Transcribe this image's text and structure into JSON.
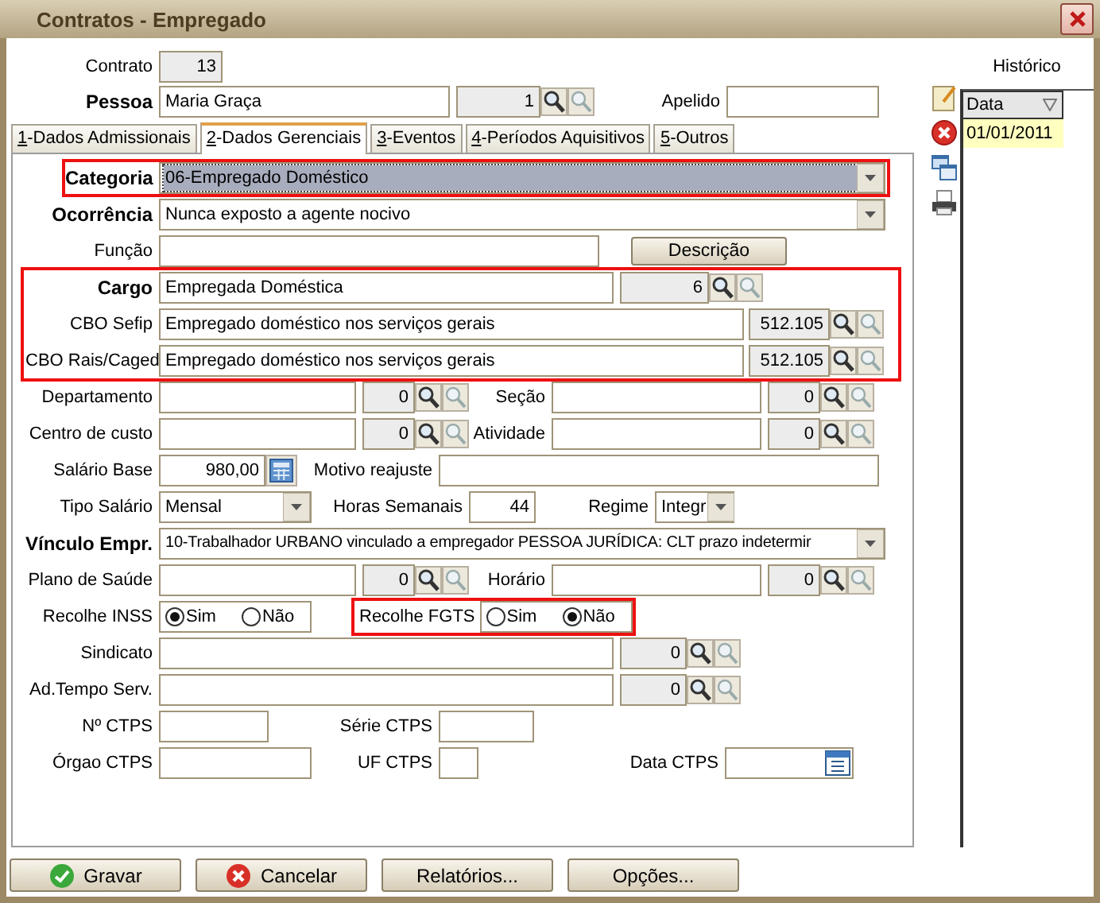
{
  "window": {
    "title": "Contratos - Empregado"
  },
  "contrato": {
    "label": "Contrato",
    "value": "13"
  },
  "pessoa": {
    "label": "Pessoa",
    "required": true,
    "value": "Maria Graça",
    "code": "1"
  },
  "apelido": {
    "label": "Apelido"
  },
  "tabs": [
    {
      "label": "1-Dados Admissionais",
      "selected": false
    },
    {
      "label": "2-Dados Gerenciais",
      "selected": true
    },
    {
      "label": "3-Eventos",
      "selected": false
    },
    {
      "label": "4-Períodos Aquisitivos",
      "selected": false
    },
    {
      "label": "5-Outros",
      "selected": false
    }
  ],
  "categoria": {
    "label": "Categoria",
    "required": true,
    "value": "06-Empregado Doméstico",
    "focused": true,
    "highlighted": true
  },
  "ocorrencia": {
    "label": "Ocorrência",
    "required": true,
    "value": "Nunca exposto a agente nocivo"
  },
  "funcao": {
    "label": "Função",
    "button": "Descrição"
  },
  "cargo_group": {
    "highlighted": true,
    "rows": [
      {
        "kind": "short",
        "label": "Cargo",
        "required": true,
        "value": "Empregada Doméstica",
        "code": "6"
      },
      {
        "kind": "wide",
        "label": "CBO Sefip",
        "required": false,
        "value": "Empregado doméstico nos serviços gerais",
        "code": "512.105"
      },
      {
        "kind": "wide",
        "label": "CBO Rais/Caged",
        "required": false,
        "value": "Empregado doméstico nos serviços gerais",
        "code": "512.105"
      }
    ]
  },
  "lookups": [
    {
      "left": {
        "label": "Departamento",
        "code": "0"
      },
      "right": {
        "label": "Seção",
        "code": "0"
      }
    },
    {
      "left": {
        "label": "Centro de custo",
        "code": "0"
      },
      "right": {
        "label": "Atividade",
        "code": "0"
      }
    }
  ],
  "salario_base": {
    "label": "Salário Base",
    "value": "980,00"
  },
  "motivo_reajuste": {
    "label": "Motivo reajuste"
  },
  "tipo_salario": {
    "label": "Tipo Salário",
    "value": "Mensal"
  },
  "horas_semanais": {
    "label": "Horas Semanais",
    "value": "44"
  },
  "regime": {
    "label": "Regime",
    "value": "Integr"
  },
  "vinculo": {
    "label": "Vínculo Empr.",
    "required": true,
    "value": "10-Trabalhador URBANO vinculado a empregador PESSOA JURÍDICA: CLT prazo indetermir"
  },
  "plano_horario": {
    "left": {
      "label": "Plano de Saúde",
      "code": "0"
    },
    "right": {
      "label": "Horário",
      "code": "0"
    }
  },
  "recolhe": [
    {
      "label": "Recolhe INSS",
      "highlighted": false,
      "options": [
        {
          "label": "Sim",
          "selected": true
        },
        {
          "label": "Não",
          "selected": false
        }
      ]
    },
    {
      "label": "Recolhe FGTS",
      "highlighted": true,
      "options": [
        {
          "label": "Sim",
          "selected": false
        },
        {
          "label": "Não",
          "selected": true
        }
      ]
    }
  ],
  "long_lookups": [
    {
      "label": "Sindicato",
      "code": "0"
    },
    {
      "label": "Ad.Tempo Serv.",
      "code": "0"
    }
  ],
  "ctps": {
    "numero": {
      "label": "Nº CTPS"
    },
    "serie": {
      "label": "Série CTPS"
    },
    "orgao": {
      "label": "Órgao CTPS"
    },
    "uf": {
      "label": "UF CTPS"
    },
    "data": {
      "label": "Data CTPS"
    }
  },
  "historico": {
    "title": "Histórico",
    "column": "Data",
    "rows": [
      {
        "value": "01/01/2011",
        "selected": true
      }
    ]
  },
  "buttons": [
    {
      "kind": "ok",
      "label": "Gravar"
    },
    {
      "kind": "cancel",
      "label": "Cancelar"
    },
    {
      "kind": "plain",
      "label": "Relatórios..."
    },
    {
      "kind": "plain",
      "label": "Opções..."
    }
  ]
}
